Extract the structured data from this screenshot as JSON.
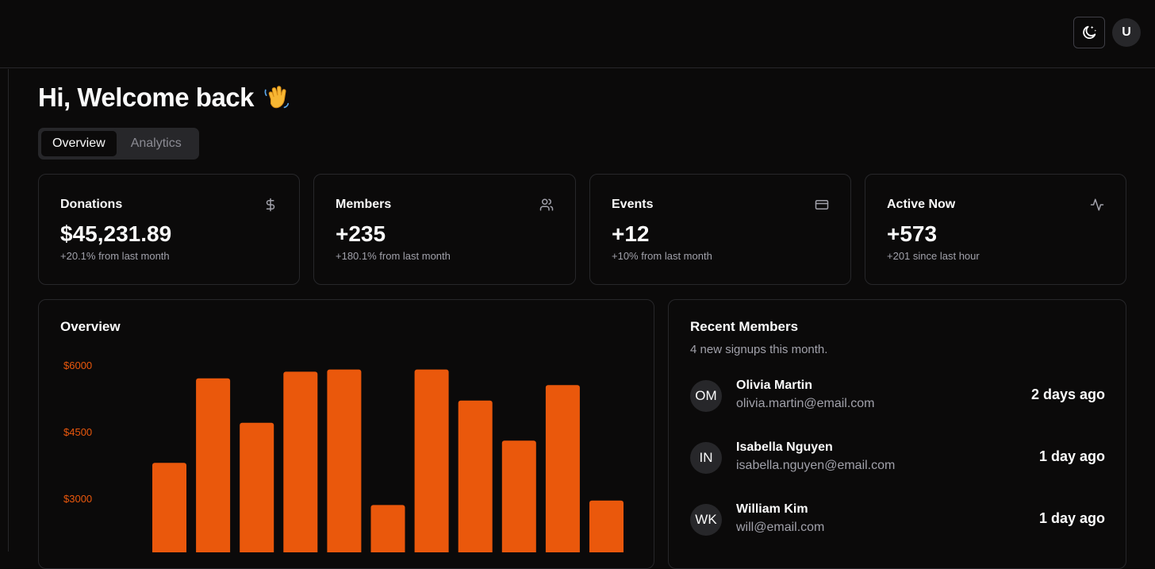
{
  "header": {
    "theme_icon": "moon-stars-icon",
    "user_initial": "U"
  },
  "page": {
    "greeting": "Hi, Welcome back",
    "greeting_emoji": "waving-hand-icon"
  },
  "tabs": [
    {
      "label": "Overview",
      "active": true
    },
    {
      "label": "Analytics",
      "active": false
    }
  ],
  "stats": [
    {
      "title": "Donations",
      "icon": "dollar-icon",
      "value": "$45,231.89",
      "sub": "+20.1% from last month"
    },
    {
      "title": "Members",
      "icon": "users-icon",
      "value": "+235",
      "sub": "+180.1% from last month"
    },
    {
      "title": "Events",
      "icon": "credit-card-icon",
      "value": "+12",
      "sub": "+10% from last month"
    },
    {
      "title": "Active Now",
      "icon": "activity-icon",
      "value": "+573",
      "sub": "+201 since last hour"
    }
  ],
  "overview": {
    "title": "Overview",
    "chart_data": {
      "type": "bar",
      "categories": [],
      "values": [
        3800,
        5700,
        4700,
        5850,
        5900,
        2850,
        5900,
        5200,
        4300,
        5550,
        2950
      ],
      "y_ticks": [
        "$6000",
        "$4500",
        "$3000"
      ],
      "y_tick_values": [
        6000,
        4500,
        3000
      ],
      "title": "",
      "xlabel": "",
      "ylabel": "",
      "bar_color": "#ea580c",
      "grid": false
    }
  },
  "recent": {
    "title": "Recent Members",
    "subtitle": "4 new signups this month.",
    "members": [
      {
        "initials": "OM",
        "name": "Olivia Martin",
        "email": "olivia.martin@email.com",
        "time": "2 days ago"
      },
      {
        "initials": "IN",
        "name": "Isabella Nguyen",
        "email": "isabella.nguyen@email.com",
        "time": "1 day ago"
      },
      {
        "initials": "WK",
        "name": "William Kim",
        "email": "will@email.com",
        "time": "1 day ago"
      }
    ]
  },
  "colors": {
    "background": "#0b0a0a",
    "border": "#27272a",
    "accent": "#ea580c",
    "muted": "#a1a1aa"
  }
}
